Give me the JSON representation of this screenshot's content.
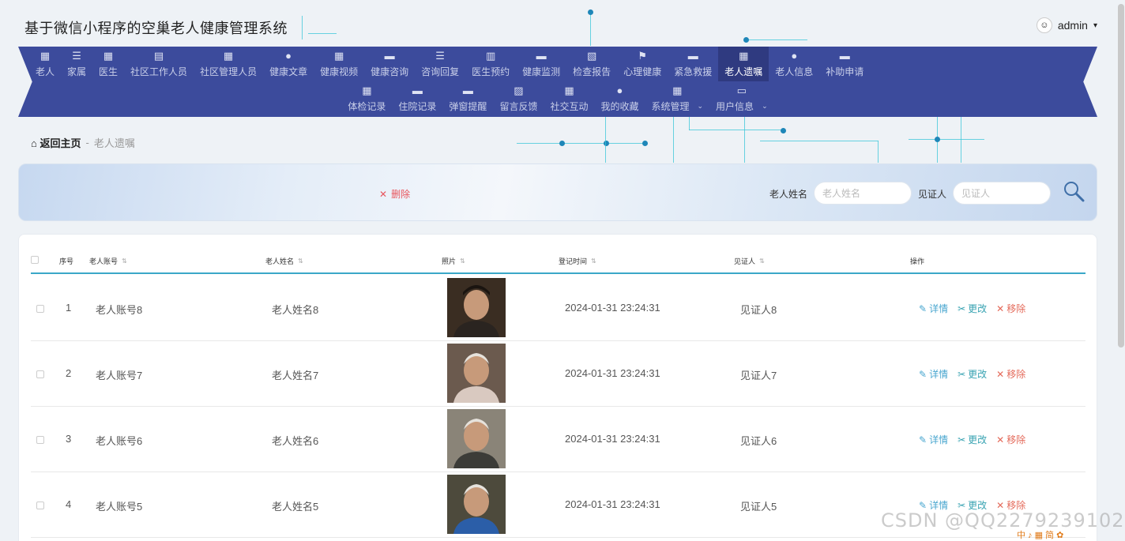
{
  "app": {
    "title": "基于微信小程序的空巢老人健康管理系统"
  },
  "user": {
    "name": "admin",
    "caret": "▾"
  },
  "nav": {
    "row1": [
      {
        "label": "老人",
        "icon": "▦"
      },
      {
        "label": "家属",
        "icon": "☰"
      },
      {
        "label": "医生",
        "icon": "▦"
      },
      {
        "label": "社区工作人员",
        "icon": "▤"
      },
      {
        "label": "社区管理人员",
        "icon": "▦"
      },
      {
        "label": "健康文章",
        "icon": "●"
      },
      {
        "label": "健康视频",
        "icon": "▦"
      },
      {
        "label": "健康咨询",
        "icon": "▬"
      },
      {
        "label": "咨询回复",
        "icon": "☰"
      },
      {
        "label": "医生预约",
        "icon": "▥"
      },
      {
        "label": "健康监测",
        "icon": "▬"
      },
      {
        "label": "检查报告",
        "icon": "▧"
      },
      {
        "label": "心理健康",
        "icon": "⚑"
      },
      {
        "label": "紧急救援",
        "icon": "▬"
      },
      {
        "label": "老人遗嘱",
        "icon": "▦"
      },
      {
        "label": "老人信息",
        "icon": "●"
      },
      {
        "label": "补助申请",
        "icon": "▬"
      }
    ],
    "row2": [
      {
        "label": "体检记录",
        "icon": "▦"
      },
      {
        "label": "住院记录",
        "icon": "▬"
      },
      {
        "label": "弹窗提醒",
        "icon": "▬"
      },
      {
        "label": "留言反馈",
        "icon": "▨"
      },
      {
        "label": "社交互动",
        "icon": "▦"
      },
      {
        "label": "我的收藏",
        "icon": "●"
      },
      {
        "label": "系统管理",
        "icon": "▦",
        "caret": "⌄"
      },
      {
        "label": "用户信息",
        "icon": "▭",
        "caret": "⌄"
      }
    ]
  },
  "breadcrumb": {
    "home": "返回主页",
    "separator": "-",
    "current": "老人遗嘱"
  },
  "search": {
    "delete_label": "删除",
    "delete_icon": "✕",
    "name_label": "老人姓名",
    "name_placeholder": "老人姓名",
    "witness_label": "见证人",
    "witness_placeholder": "见证人"
  },
  "table": {
    "headers": {
      "index": "序号",
      "account": "老人账号",
      "name": "老人姓名",
      "photo": "照片",
      "time": "登记时间",
      "witness": "见证人",
      "actions": "操作"
    },
    "rows": [
      {
        "index": "1",
        "account": "老人账号8",
        "name": "老人姓名8",
        "time": "2024-01-31 23:24:31",
        "witness": "见证人8"
      },
      {
        "index": "2",
        "account": "老人账号7",
        "name": "老人姓名7",
        "time": "2024-01-31 23:24:31",
        "witness": "见证人7"
      },
      {
        "index": "3",
        "account": "老人账号6",
        "name": "老人姓名6",
        "time": "2024-01-31 23:24:31",
        "witness": "见证人6"
      },
      {
        "index": "4",
        "account": "老人账号5",
        "name": "老人姓名5",
        "time": "2024-01-31 23:24:31",
        "witness": "见证人5"
      }
    ],
    "actions": {
      "detail": "详情",
      "edit": "更改",
      "remove": "移除"
    }
  },
  "watermark": "CSDN @QQ2279239102",
  "tray": "中 ♪ ▦ 简 ✿",
  "colors": {
    "nav_bg": "#3c4b9c",
    "nav_active": "#2f3a80",
    "accent_line": "#3aa8c8",
    "delete_red": "#e8555d"
  }
}
